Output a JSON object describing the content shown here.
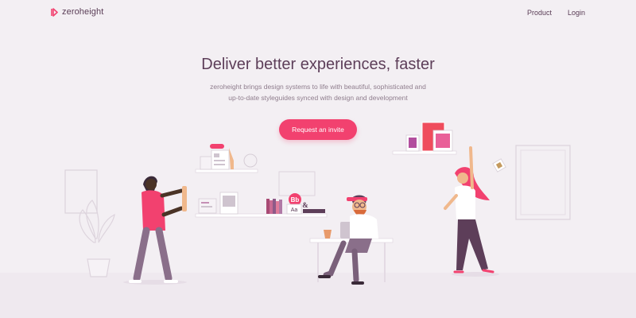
{
  "brand": {
    "name": "zeroheight",
    "accent": "#f2416f",
    "text_color": "#5d3e59"
  },
  "nav": {
    "product_label": "Product",
    "login_label": "Login"
  },
  "hero": {
    "title": "Deliver better experiences, faster",
    "subtitle_line1": "zeroheight brings design systems to life with beautiful, sophisticated and",
    "subtitle_line2": "up-to-date styleguides synced with design and development",
    "cta_label": "Request an invite"
  },
  "illustration": {
    "type_card_bb": "Bb",
    "type_card_aa": "Aa",
    "type_card_amp": "&"
  }
}
